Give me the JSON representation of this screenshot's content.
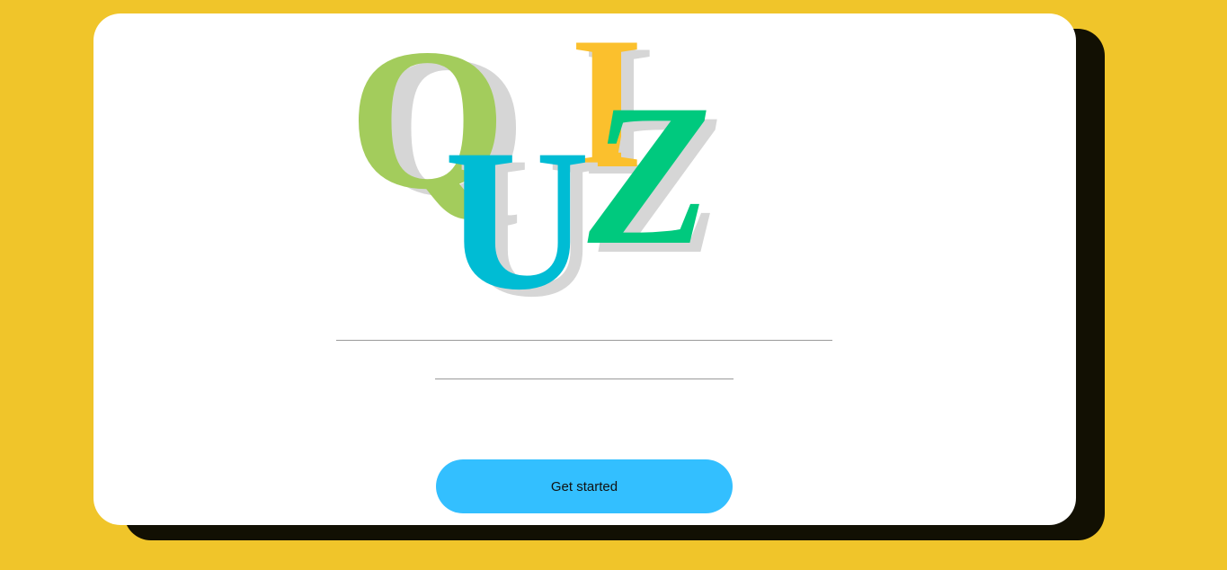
{
  "logo": {
    "letters": [
      "Q",
      "U",
      "I",
      "Z"
    ],
    "colors": {
      "Q": "#a3cc5c",
      "U": "#00bcd4",
      "I": "#fbc02d",
      "Z": "#00c97e",
      "shadow": "#d6d6d6"
    }
  },
  "form": {
    "field_one_value": "",
    "field_two_value": ""
  },
  "actions": {
    "get_started_label": "Get started"
  },
  "theme": {
    "background": "#f0c52a",
    "card": "#ffffff",
    "card_shadow": "#121003",
    "button": "#33bfff"
  }
}
